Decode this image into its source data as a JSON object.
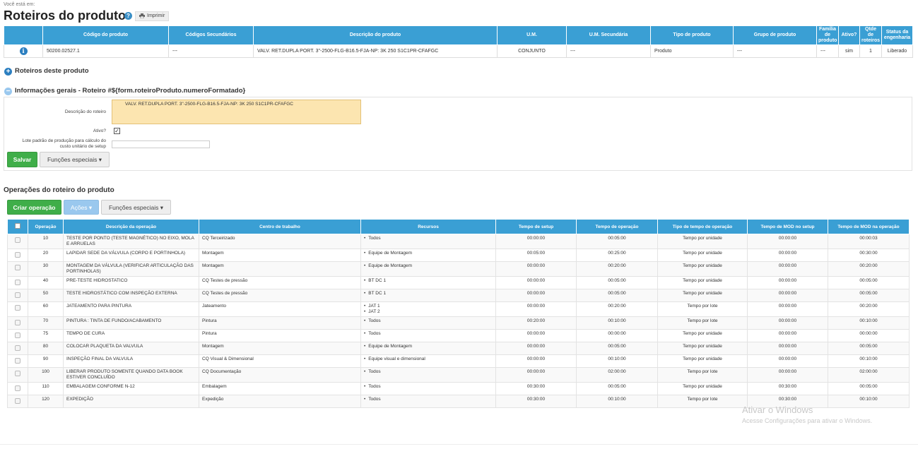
{
  "breadcrumb": "Você está em:",
  "page_title": "Roteiros do produto",
  "help_icon": "?",
  "print_label": "Imprimir",
  "product_table": {
    "headers": [
      "Código do produto",
      "Códigos Secundários",
      "Descrição do produto",
      "U.M.",
      "U.M. Secundária",
      "Tipo de produto",
      "Grupo de produto",
      "Família de produto",
      "Ativo?",
      "Qtde de roteiros",
      "Status da engenharia"
    ],
    "row": {
      "codigo": "50200.02527.1",
      "secundarios": "---",
      "descricao": "VALV. RET.DUPLA PORT. 3\"-2500-FLG-B16.5-FJA-NP: 3K 250 S1C1PR-CFAFGC",
      "um": "CONJUNTO",
      "um_secundaria": "---",
      "tipo": "Produto",
      "grupo": "---",
      "familia": "---",
      "ativo": "sim",
      "qtde": "1",
      "status": "Liberado"
    }
  },
  "section_roteiros": "Roteiros deste produto",
  "section_info": "Informações gerais - Roteiro #${form.roteiroProduto.numeroFormatado}",
  "form": {
    "descricao_label": "Descrição do roteiro",
    "descricao_value": "VALV. RET.DUPLA PORT. 3\"-2500-FLG-B16.5-FJA-NP: 3K 250 S1C1PR-CFAFGC",
    "ativo_label": "Ativo?",
    "ativo_checked": true,
    "lote_label_1": "Lote padrão de produção para cálculo do",
    "lote_label_2": "custo unitário de setup",
    "lote_value": "",
    "save_label": "Salvar",
    "special_label": "Funções especiais ▾"
  },
  "ops_title": "Operações do roteiro do produto",
  "ops_toolbar": {
    "create_label": "Criar operação",
    "actions_label": "Ações ▾",
    "special_label": "Funções especiais ▾"
  },
  "ops_table": {
    "headers": [
      "Operação",
      "Descrição da operação",
      "Centro de trabalho",
      "Recursos",
      "Tempo de setup",
      "Tempo de operação",
      "Tipo de tempo de operação",
      "Tempo de MOD no setup",
      "Tempo de MOD na operação"
    ],
    "rows": [
      {
        "op": "10",
        "desc": "TESTE POR PONTO (TESTE MAGNÉTICO) NO EIXO, MOLA E ARRUELAS",
        "centro": "CQ Terceirizado",
        "recursos": [
          "Todos"
        ],
        "setup": "00:00:00",
        "operacao": "00:05:00",
        "tipo": "Tempo por unidade",
        "mod_setup": "00:00:00",
        "mod_op": "00:00:03"
      },
      {
        "op": "20",
        "desc": "LAPIDAR SEDE DA VÁLVULA (CORPO E PORTINHOLA)",
        "centro": "Montagem",
        "recursos": [
          "Equipe de Montagem"
        ],
        "setup": "00:05:00",
        "operacao": "00:25:00",
        "tipo": "Tempo por unidade",
        "mod_setup": "00:00:00",
        "mod_op": "00:30:00"
      },
      {
        "op": "30",
        "desc": "MONTAGEM DA VÁLVULA (VERIFICAR ARTICULAÇÃO DAS PORTINHOLAS)",
        "centro": "Montagem",
        "recursos": [
          "Equipe de Montagem"
        ],
        "setup": "00:00:00",
        "operacao": "00:20:00",
        "tipo": "Tempo por unidade",
        "mod_setup": "00:00:00",
        "mod_op": "00:20:00"
      },
      {
        "op": "40",
        "desc": "PRE-TESTE HIDROSTATICO",
        "centro": "CQ Testes de pressão",
        "recursos": [
          "BT DC 1"
        ],
        "setup": "00:00:00",
        "operacao": "00:05:00",
        "tipo": "Tempo por unidade",
        "mod_setup": "00:00:00",
        "mod_op": "00:05:00"
      },
      {
        "op": "50",
        "desc": "TESTE HIDROSTÁTICO COM INSPEÇÃO EXTERNA",
        "centro": "CQ Testes de pressão",
        "recursos": [
          "BT DC 1"
        ],
        "setup": "00:00:00",
        "operacao": "00:05:00",
        "tipo": "Tempo por unidade",
        "mod_setup": "00:00:00",
        "mod_op": "00:05:00"
      },
      {
        "op": "60",
        "desc": "JATEAMENTO PARA PINTURA",
        "centro": "Jateamento",
        "recursos": [
          "JAT 1",
          "JAT 2"
        ],
        "setup": "00:00:00",
        "operacao": "00:20:00",
        "tipo": "Tempo por lote",
        "mod_setup": "00:00:00",
        "mod_op": "00:20:00"
      },
      {
        "op": "70",
        "desc": "PINTURA : TINTA DE FUNDO/ACABAMENTO",
        "centro": "Pintura",
        "recursos": [
          "Todos"
        ],
        "setup": "00:20:00",
        "operacao": "00:10:00",
        "tipo": "Tempo por lote",
        "mod_setup": "00:00:00",
        "mod_op": "00:10:00"
      },
      {
        "op": "75",
        "desc": "TEMPO DE CURA",
        "centro": "Pintura",
        "recursos": [
          "Todos"
        ],
        "setup": "00:00:00",
        "operacao": "00:00:00",
        "tipo": "Tempo por unidade",
        "mod_setup": "00:00:00",
        "mod_op": "00:00:00"
      },
      {
        "op": "80",
        "desc": "COLOCAR PLAQUETA DA VALVULA",
        "centro": "Montagem",
        "recursos": [
          "Equipe de Montagem"
        ],
        "setup": "00:00:00",
        "operacao": "00:05:00",
        "tipo": "Tempo por unidade",
        "mod_setup": "00:00:00",
        "mod_op": "00:05:00"
      },
      {
        "op": "90",
        "desc": "INSPEÇÃO FINAL DA VALVULA",
        "centro": "CQ Visual & Dimensional",
        "recursos": [
          "Equipe visual e dimensional"
        ],
        "setup": "00:00:00",
        "operacao": "00:10:00",
        "tipo": "Tempo por unidade",
        "mod_setup": "00:00:00",
        "mod_op": "00:10:00"
      },
      {
        "op": "100",
        "desc": "LIBERAR PRODUTO SOMENTE QUANDO DATA BOOK ESTIVER CONCLUÍDO",
        "centro": "CQ Documentação",
        "recursos": [
          "Todos"
        ],
        "setup": "00:00:00",
        "operacao": "02:00:00",
        "tipo": "Tempo por lote",
        "mod_setup": "00:00:00",
        "mod_op": "02:00:00"
      },
      {
        "op": "110",
        "desc": "EMBALAGEM CONFORME N-12",
        "centro": "Embalagem",
        "recursos": [
          "Todos"
        ],
        "setup": "00:30:00",
        "operacao": "00:05:00",
        "tipo": "Tempo por unidade",
        "mod_setup": "00:30:00",
        "mod_op": "00:05:00"
      },
      {
        "op": "120",
        "desc": "EXPEDIÇÃO",
        "centro": "Expedição",
        "recursos": [
          "Todos"
        ],
        "setup": "00:30:00",
        "operacao": "00:10:00",
        "tipo": "Tempo por lote",
        "mod_setup": "00:30:00",
        "mod_op": "00:10:00"
      }
    ]
  },
  "watermark": {
    "line1": "Ativar o Windows",
    "line2": "Acesse Configurações para ativar o Windows."
  }
}
